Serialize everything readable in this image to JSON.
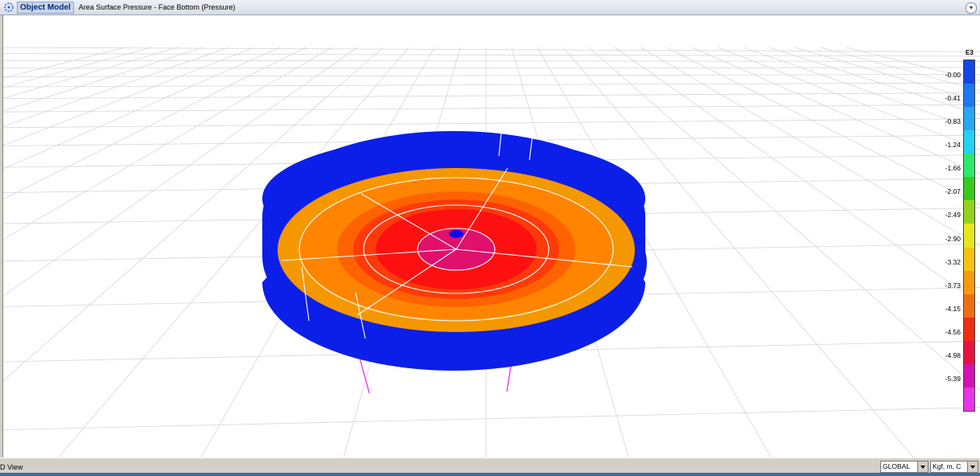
{
  "view": {
    "tab_label": "Object Model",
    "title": "Area Surface Pressure - Face Bottom (Pressure)"
  },
  "legend": {
    "title": "E3",
    "labels": [
      "-0.00",
      "-0.41",
      "-0.83",
      "-1.24",
      "-1.66",
      "-2.07",
      "-2.49",
      "-2.90",
      "-3.32",
      "-3.73",
      "-4.15",
      "-4.56",
      "-4.98",
      "-5.39"
    ],
    "colors": [
      "#1446e6",
      "#1e78ef",
      "#2aa6f2",
      "#23d2f5",
      "#2ee86c",
      "#3cc81d",
      "#94d21c",
      "#e6e61e",
      "#f5c314",
      "#f59b0f",
      "#ee6e14",
      "#ee2d14",
      "#e41440",
      "#d214b4",
      "#e636e6"
    ]
  },
  "status": {
    "left_text": "D View",
    "coord_system": "GLOBAL",
    "units": "Kgf, m, C"
  },
  "colors": {
    "tank_wall": "#0b1fe8",
    "outer_ring": "#f59800",
    "ring2": "#ff7a00",
    "ring3": "#ff4a00",
    "ring4": "#ff2a10",
    "inner_core": "#ff0000",
    "center_disk": "#e0106c",
    "center_node": "#0a0af0",
    "support_line": "#e620e6"
  }
}
